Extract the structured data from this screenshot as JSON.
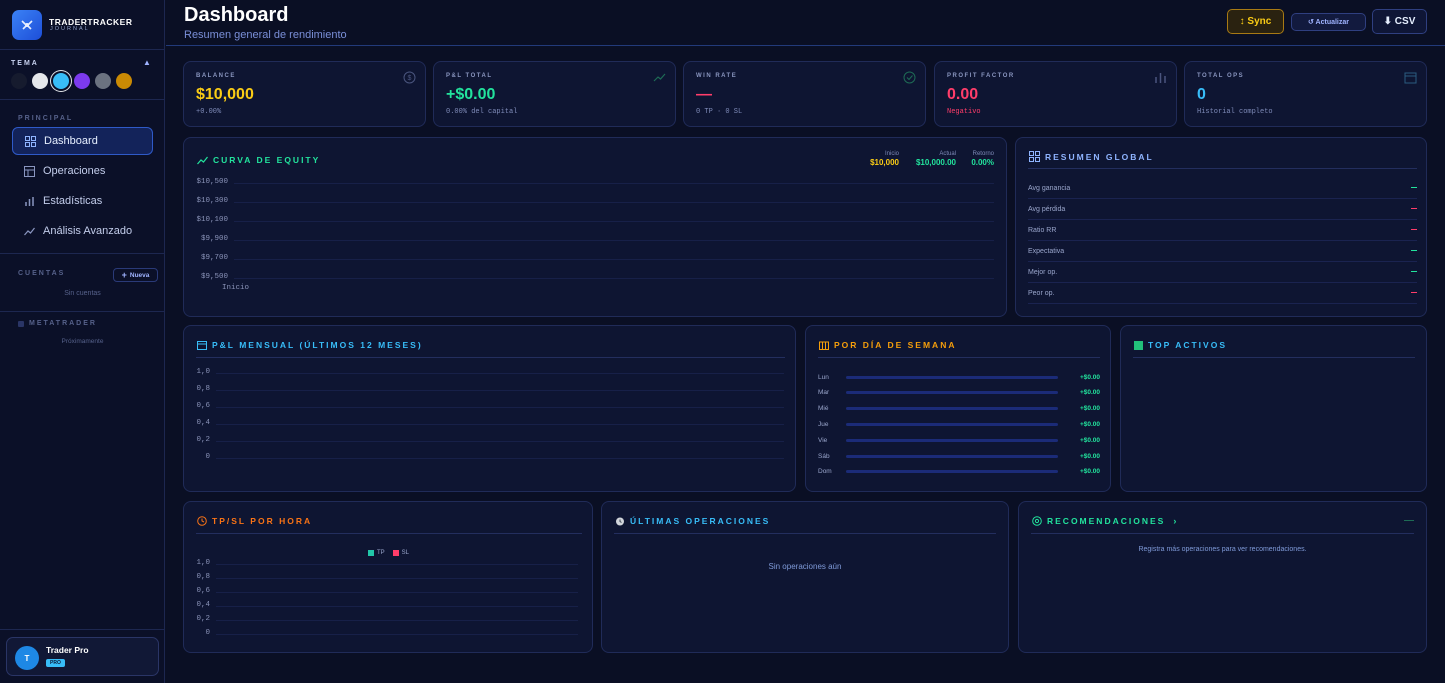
{
  "colors": {
    "bg": "#0a0f24",
    "panel": "#0e1532",
    "accent": "#38bdf8",
    "positive": "#22e39d",
    "negative": "#ff3d6a",
    "gold": "#facc15"
  },
  "sidebar": {
    "brand_line1": "TRADERTRACKER",
    "brand_line2": "JOURNAL",
    "theme_label": "TEMA",
    "theme_colors": [
      "#161b2e",
      "#e5e7eb",
      "#38bdf8",
      "#7c3aed",
      "#6b7280",
      "#ca8a04"
    ],
    "principal_label": "PRINCIPAL",
    "nav": [
      {
        "label": "Dashboard",
        "icon": "grid-icon",
        "active": true
      },
      {
        "label": "Operaciones",
        "icon": "table-icon",
        "active": false
      },
      {
        "label": "Estadísticas",
        "icon": "bar-chart-icon",
        "active": false
      },
      {
        "label": "Análisis Avanzado",
        "icon": "trend-icon",
        "active": false
      }
    ],
    "accounts_label": "CUENTAS",
    "new_button": "Nueva",
    "no_accounts": "Sin cuentas",
    "metatrader_label": "METATRADER",
    "coming_soon": "Próximamente",
    "user_name": "Trader Pro",
    "user_initial": "T",
    "user_badge": "PRO"
  },
  "header": {
    "title": "Dashboard",
    "subtitle": "Resumen general de rendimiento",
    "sync": "↕ Sync",
    "refresh": "↺ Actualizar",
    "csv": "⬇ CSV"
  },
  "stats": [
    {
      "label": "BALANCE",
      "value": "$10,000",
      "sub": "+0.00%",
      "color": "#facc15",
      "icon": "dollar-circle-icon"
    },
    {
      "label": "P&L TOTAL",
      "value": "+$0.00",
      "sub": "0.00% del capital",
      "color": "#22e39d",
      "icon": "trend-up-icon"
    },
    {
      "label": "WIN RATE",
      "value": "—",
      "sub": "0 TP · 0 SL",
      "color": "#ff3d6a",
      "icon": "target-icon"
    },
    {
      "label": "PROFIT FACTOR",
      "value": "0.00",
      "sub": "Negativo",
      "color": "#ff3d6a",
      "icon": "bars-icon"
    },
    {
      "label": "TOTAL OPS",
      "value": "0",
      "sub": "Historial completo",
      "color": "#38bdf8",
      "icon": "calendar-icon"
    }
  ],
  "equity": {
    "title": "CURVA DE EQUITY",
    "inicio_label": "Inicio",
    "inicio_value": "$10,000",
    "actual_label": "Actual",
    "actual_value": "$10,000.00",
    "retorno_label": "Retorno",
    "retorno_value": "0.00%",
    "y_ticks": [
      "$10,500",
      "$10,300",
      "$10,100",
      "$9,900",
      "$9,700",
      "$9,500"
    ],
    "x_label": "Inicio"
  },
  "resumen": {
    "title": "RESUMEN GLOBAL",
    "rows": [
      {
        "label": "Avg ganancia",
        "color": "#22e39d"
      },
      {
        "label": "Avg pérdida",
        "color": "#ff3d6a"
      },
      {
        "label": "Ratio RR",
        "color": "#ff3d6a"
      },
      {
        "label": "Expectativa",
        "color": "#22e39d"
      },
      {
        "label": "Mejor op.",
        "color": "#22e39d"
      },
      {
        "label": "Peor op.",
        "color": "#ff3d6a"
      }
    ]
  },
  "monthly": {
    "title": "P&L MENSUAL (ÚLTIMOS 12 MESES)",
    "y_ticks": [
      "1,0",
      "0,8",
      "0,6",
      "0,4",
      "0,2",
      "0"
    ]
  },
  "weekday": {
    "title": "POR DÍA DE SEMANA",
    "days": [
      {
        "label": "Lun",
        "value": "+$0.00"
      },
      {
        "label": "Mar",
        "value": "+$0.00"
      },
      {
        "label": "Mié",
        "value": "+$0.00"
      },
      {
        "label": "Jue",
        "value": "+$0.00"
      },
      {
        "label": "Vie",
        "value": "+$0.00"
      },
      {
        "label": "Sáb",
        "value": "+$0.00"
      },
      {
        "label": "Dom",
        "value": "+$0.00"
      }
    ]
  },
  "top": {
    "title": "TOP ACTIVOS"
  },
  "hourly": {
    "title": "TP/SL POR HORA",
    "legend_tp": "TP",
    "legend_sl": "SL",
    "y_ticks": [
      "1,0",
      "0,8",
      "0,6",
      "0,4",
      "0,2",
      "0"
    ]
  },
  "recent": {
    "title": "ÚLTIMAS OPERACIONES",
    "empty": "Sin operaciones aún"
  },
  "recs": {
    "title": "RECOMENDACIONES",
    "empty": "Registra más operaciones para ver recomendaciones."
  }
}
